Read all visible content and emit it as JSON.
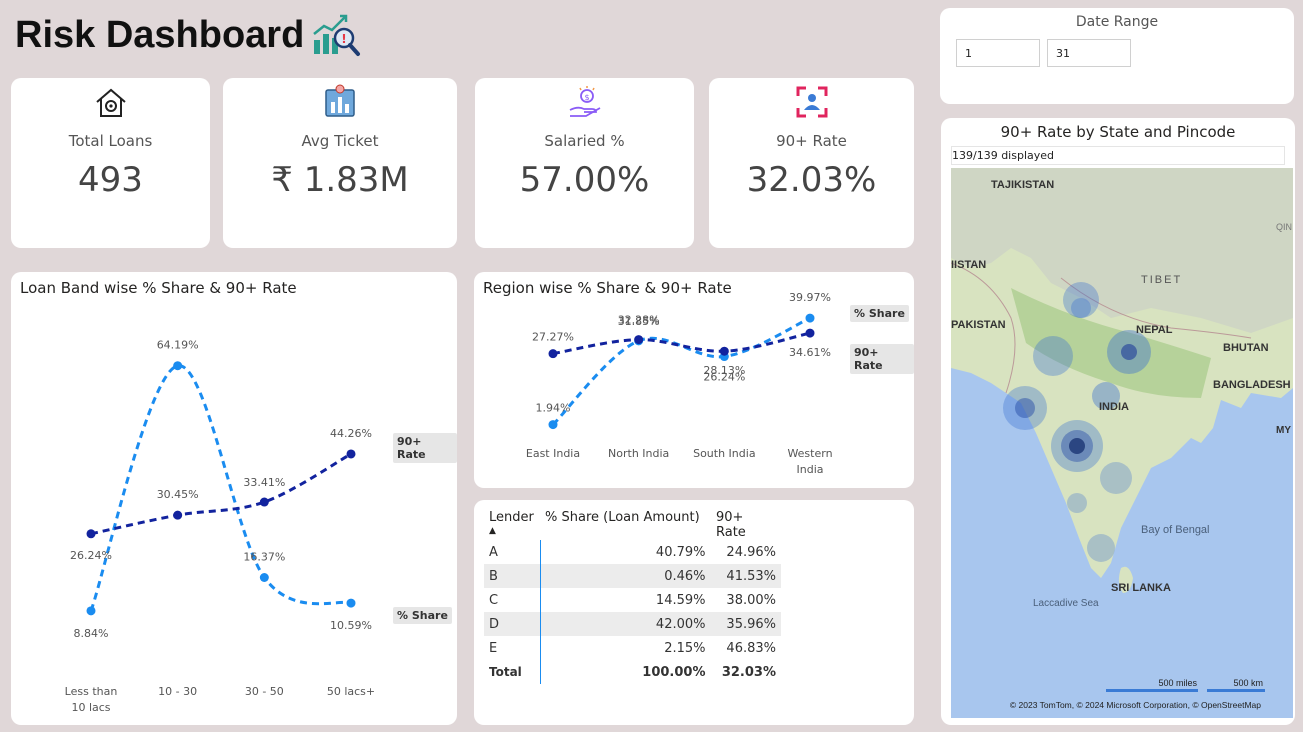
{
  "header": {
    "title": "Risk Dashboard",
    "icon": "chart-magnifier-icon"
  },
  "kpis": [
    {
      "label": "Total Loans",
      "value": "493",
      "icon": "house-gear-icon"
    },
    {
      "label": "Avg Ticket",
      "value": "₹ 1.83M",
      "icon": "bar-chart-icon"
    },
    {
      "label": "Salaried %",
      "value": "57.00%",
      "icon": "hand-coin-icon"
    },
    {
      "label": "90+ Rate",
      "value": "32.03%",
      "icon": "person-focus-icon"
    }
  ],
  "date_range": {
    "title": "Date Range",
    "start": "1",
    "end": "31"
  },
  "loan_band_chart": {
    "title": "Loan Band wise % Share & 90+ Rate",
    "legend_rate": "90+ Rate",
    "legend_share": "% Share"
  },
  "region_chart": {
    "title": "Region wise % Share & 90+ Rate",
    "legend_share": "% Share",
    "legend_rate": "90+ Rate"
  },
  "chart_data": [
    {
      "type": "line",
      "title": "Loan Band wise % Share & 90+ Rate",
      "categories": [
        "Less than 10 lacs",
        "10 - 30",
        "30 - 50",
        "50 lacs+"
      ],
      "series": [
        {
          "name": "% Share",
          "values": [
            8.84,
            64.19,
            16.37,
            10.59
          ],
          "labels": [
            "8.84%",
            "64.19%",
            "16.37%",
            "10.59%"
          ],
          "color": "#1a8cf0"
        },
        {
          "name": "90+ Rate",
          "values": [
            26.24,
            30.45,
            33.41,
            44.26
          ],
          "labels": [
            "26.24%",
            "30.45%",
            "33.41%",
            "44.26%"
          ],
          "color": "#12239e"
        }
      ]
    },
    {
      "type": "line",
      "title": "Region wise % Share & 90+ Rate",
      "categories": [
        "East India",
        "North India",
        "South India",
        "Western India"
      ],
      "series": [
        {
          "name": "% Share",
          "values": [
            1.94,
            31.85,
            26.24,
            39.97
          ],
          "labels": [
            "1.94%",
            "31.85%",
            "26.24%",
            "39.97%"
          ],
          "color": "#1a8cf0"
        },
        {
          "name": "90+ Rate",
          "values": [
            27.27,
            32.28,
            28.13,
            34.61
          ],
          "labels": [
            "27.27%",
            "32.28%",
            "28.13%",
            "34.61%"
          ],
          "color": "#12239e"
        }
      ]
    }
  ],
  "lender_table": {
    "headers": [
      "Lender",
      "% Share (Loan Amount)",
      "90+ Rate"
    ],
    "rows": [
      [
        "A",
        "40.79%",
        "24.96%"
      ],
      [
        "B",
        "0.46%",
        "41.53%"
      ],
      [
        "C",
        "14.59%",
        "38.00%"
      ],
      [
        "D",
        "42.00%",
        "35.96%"
      ],
      [
        "E",
        "2.15%",
        "46.83%"
      ]
    ],
    "total": [
      "Total",
      "100.00%",
      "32.03%"
    ]
  },
  "map": {
    "title": "90+ Rate by State and Pincode",
    "displayed": "139/139 displayed",
    "labels": [
      "TAJIKISTAN",
      "IISTAN",
      "TIBET",
      "PAKISTAN",
      "NEPAL",
      "BHUTAN",
      "BANGLADESH",
      "INDIA",
      "QIN",
      "MY",
      "Bay of Bengal",
      "SRI LANKA",
      "Laccadive Sea"
    ],
    "scale_miles": "500 miles",
    "scale_km": "500 km",
    "attribution": "© 2023 TomTom, © 2024 Microsoft Corporation, © OpenStreetMap"
  }
}
